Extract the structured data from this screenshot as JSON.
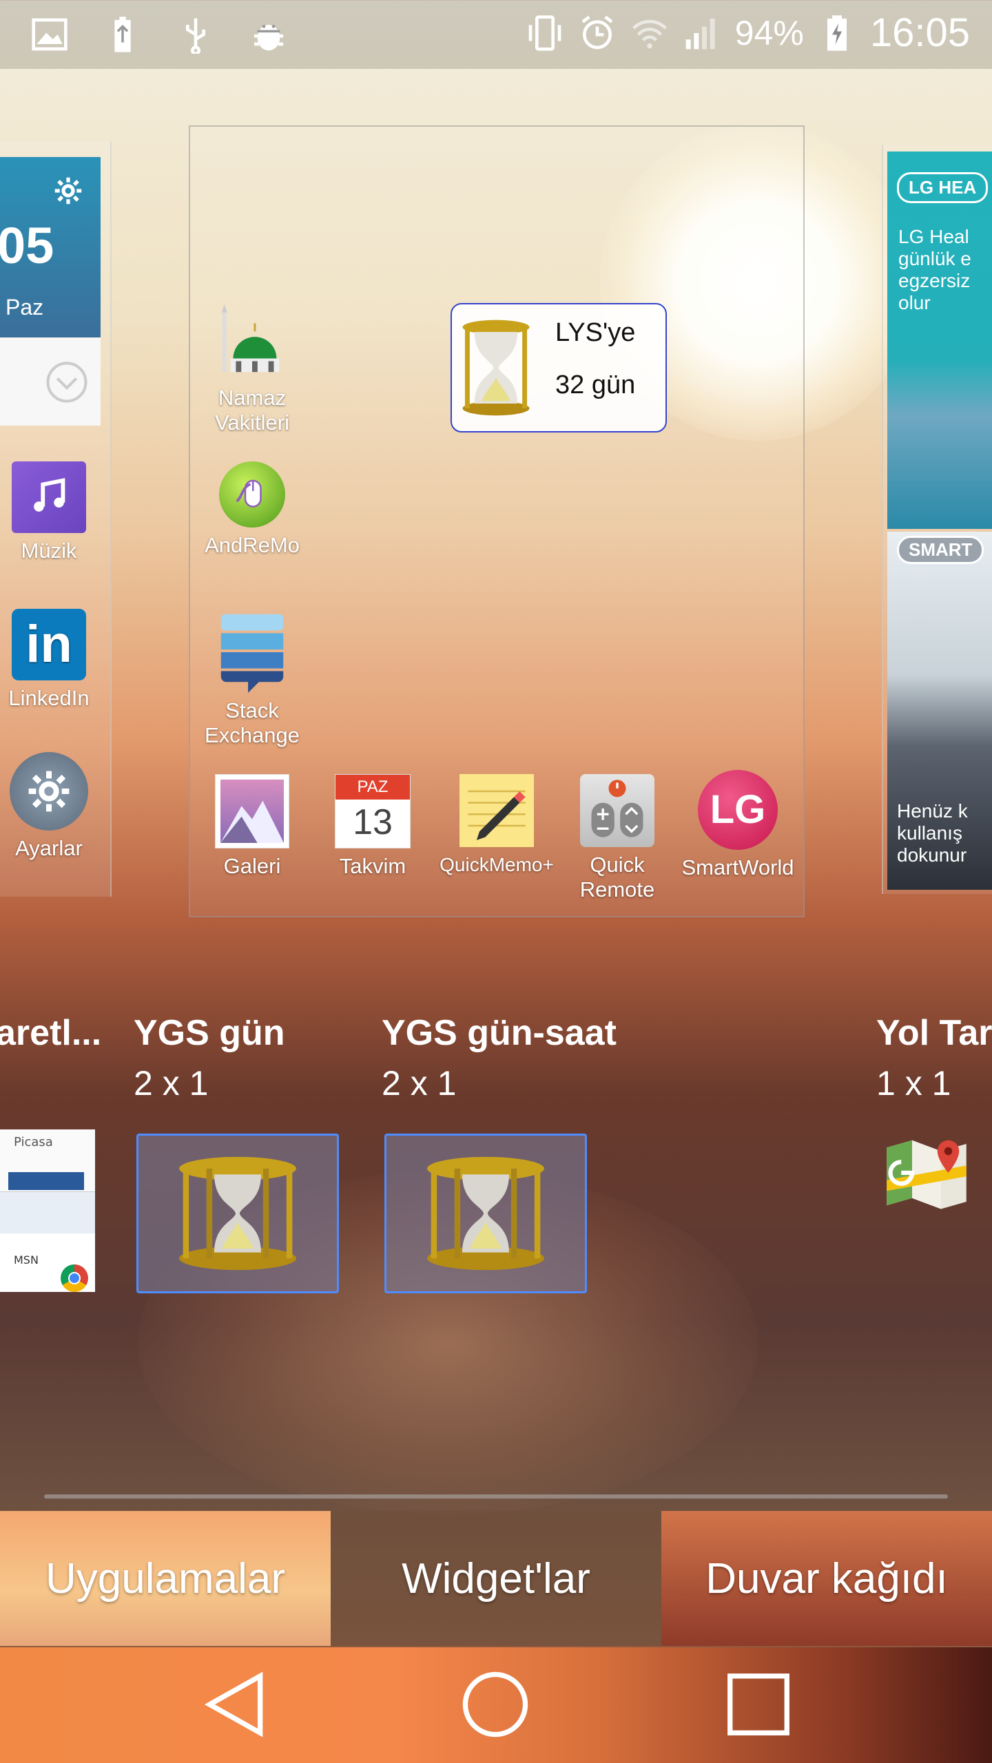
{
  "status_bar": {
    "left_icons": [
      "image-icon",
      "battery-usb-icon",
      "usb-icon",
      "android-debug-icon"
    ],
    "right_icons": [
      "vibrate-icon",
      "alarm-icon",
      "wifi-icon",
      "signal-icon",
      "battery-charging-icon"
    ],
    "battery_percent": "94%",
    "time": "16:05"
  },
  "left_page": {
    "clock_widget": {
      "time_fragment": "05",
      "day": "Paz"
    },
    "apps": [
      {
        "label": "Müzik",
        "icon": "music-icon"
      },
      {
        "label": "LinkedIn",
        "icon": "linkedin-icon"
      },
      {
        "label": "Ayarlar",
        "icon": "settings-icon"
      }
    ]
  },
  "home_page": {
    "apps": [
      {
        "label": "Namaz\nVakitleri",
        "line1": "Namaz",
        "line2": "Vakitleri",
        "icon": "mosque-icon"
      },
      {
        "label": "AndReMo",
        "icon": "mouse-icon"
      },
      {
        "label": "Stack\nExchange",
        "line1": "Stack",
        "line2": "Exchange",
        "icon": "stack-exchange-icon"
      }
    ],
    "countdown_widget": {
      "line1": "LYS'ye",
      "line2": "32 gün"
    },
    "dock": [
      {
        "label": "Galeri",
        "icon": "gallery-icon"
      },
      {
        "label": "Takvim",
        "icon": "calendar-icon",
        "cal_month": "PAZ",
        "cal_day": "13"
      },
      {
        "label": "QuickMemo+",
        "icon": "notepad-icon"
      },
      {
        "label1": "Quick",
        "label2": "Remote",
        "icon": "remote-icon"
      },
      {
        "label": "SmartWorld",
        "icon": "lg-icon",
        "logo_text": "LG"
      }
    ]
  },
  "right_page": {
    "banner1": "LG HEA",
    "banner1_text": "LG Heal\ngünlük e\negzersiz\nolur",
    "banner2": "SMART",
    "banner2_text": "Henüz k\nkullanış\ndokunur"
  },
  "widgets": [
    {
      "name": "aretl...",
      "size": ""
    },
    {
      "name": "YGS gün",
      "size": "2 x 1"
    },
    {
      "name": "YGS gün-saat",
      "size": "2 x 1"
    },
    {
      "name": "Yol Tar",
      "size": "1 x 1"
    }
  ],
  "partial_thumb": {
    "picasa": "Picasa",
    "msn": "MSN"
  },
  "tabs": [
    {
      "label": "Uygulamalar"
    },
    {
      "label": "Widget'lar"
    },
    {
      "label": "Duvar kağıdı"
    }
  ],
  "nav": [
    "back-icon",
    "home-icon",
    "recents-icon"
  ]
}
